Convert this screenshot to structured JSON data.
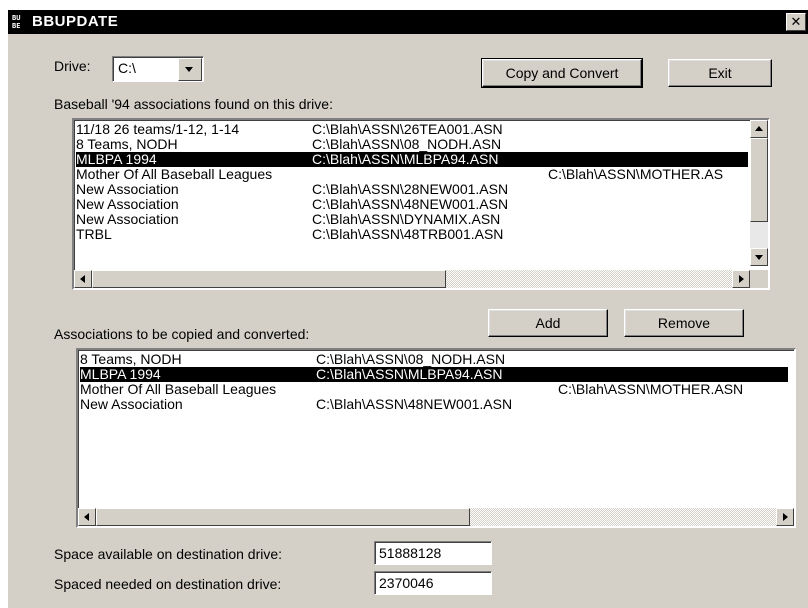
{
  "window": {
    "title": "BBUPDATE",
    "icon_text": "BU BE",
    "close_glyph": "✕"
  },
  "drive": {
    "label": "Drive:",
    "value": "C:\\"
  },
  "buttons": {
    "copy_convert": "Copy and Convert",
    "exit": "Exit",
    "add": "Add",
    "remove": "Remove"
  },
  "found_list": {
    "label": "Baseball '94 associations found on this drive:",
    "selected_index": 2,
    "rows": [
      {
        "name": "11/18 26 teams/1-12, 1-14",
        "path": "C:\\Blah\\ASSN\\26TEA001.ASN"
      },
      {
        "name": "8 Teams, NODH",
        "path": "C:\\Blah\\ASSN\\08_NODH.ASN"
      },
      {
        "name": "MLBPA 1994",
        "path": "C:\\Blah\\ASSN\\MLBPA94.ASN"
      },
      {
        "name": "Mother Of All Baseball Leagues",
        "path": "C:\\Blah\\ASSN\\MOTHER.AS"
      },
      {
        "name": "New Association",
        "path": "C:\\Blah\\ASSN\\28NEW001.ASN"
      },
      {
        "name": "New Association",
        "path": "C:\\Blah\\ASSN\\48NEW001.ASN"
      },
      {
        "name": "New Association",
        "path": "C:\\Blah\\ASSN\\DYNAMIX.ASN"
      },
      {
        "name": "TRBL",
        "path": "C:\\Blah\\ASSN\\48TRB001.ASN"
      }
    ]
  },
  "copy_list": {
    "label": "Associations to be copied and converted:",
    "selected_index": 1,
    "rows": [
      {
        "name": "8 Teams, NODH",
        "path": "C:\\Blah\\ASSN\\08_NODH.ASN"
      },
      {
        "name": "MLBPA 1994",
        "path": "C:\\Blah\\ASSN\\MLBPA94.ASN"
      },
      {
        "name": "Mother Of All Baseball Leagues",
        "path": "C:\\Blah\\ASSN\\MOTHER.ASN"
      },
      {
        "name": "New Association",
        "path": "C:\\Blah\\ASSN\\48NEW001.ASN"
      }
    ]
  },
  "space": {
    "available_label": "Space available on destination drive:",
    "available_value": "51888128",
    "needed_label": "Spaced needed on destination drive:",
    "needed_value": "2370046"
  },
  "colors": {
    "face": "#d4d0c8",
    "selection": "#000000",
    "titlebar": "#000000"
  }
}
